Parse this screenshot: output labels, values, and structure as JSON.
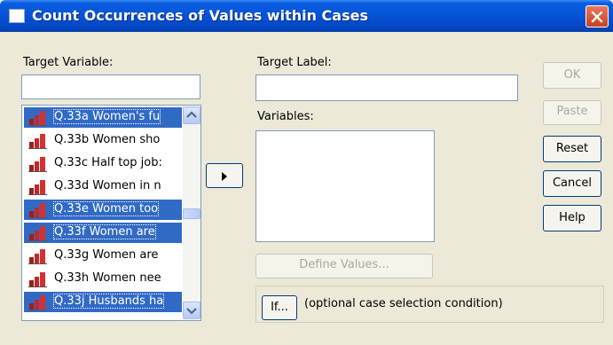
{
  "window": {
    "title": "Count Occurrences of Values within Cases",
    "icon": "window-app-icon",
    "close_icon": "close-icon"
  },
  "target_variable": {
    "label": "Target Variable:",
    "value": ""
  },
  "target_label": {
    "label": "Target Label:",
    "value": ""
  },
  "variables": {
    "label": "Variables:"
  },
  "source_list": {
    "items": [
      {
        "label": "Q.33a Women's fu",
        "selected": true
      },
      {
        "label": "Q.33b Women sho",
        "selected": false
      },
      {
        "label": "Q.33c Half top job:",
        "selected": false
      },
      {
        "label": "Q.33d Women in n",
        "selected": false
      },
      {
        "label": "Q.33e Women too",
        "selected": true
      },
      {
        "label": "Q.33f Women are",
        "selected": true
      },
      {
        "label": "Q.33g Women are",
        "selected": false
      },
      {
        "label": "Q.33h Women nee",
        "selected": false
      },
      {
        "label": "Q.33j Husbands ha",
        "selected": true
      }
    ],
    "item_icon": "scale-variable-icon"
  },
  "buttons": {
    "ok": "OK",
    "paste": "Paste",
    "reset": "Reset",
    "cancel": "Cancel",
    "help": "Help",
    "move": "right-arrow-icon",
    "define_values": "Define Values...",
    "if": "If..."
  },
  "if_panel": {
    "text": "(optional case selection condition)"
  },
  "colors": {
    "selection": "#316ac5",
    "titlebar": "#0553d6",
    "dialog": "#ece9d8"
  }
}
